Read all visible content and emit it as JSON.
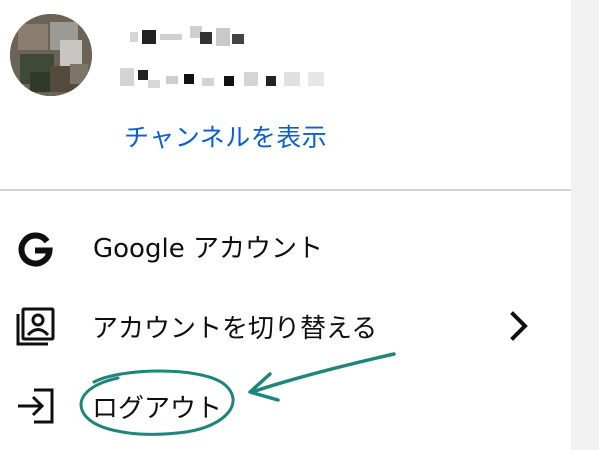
{
  "account": {
    "channel_link": "チャンネルを表示"
  },
  "menu": {
    "items": [
      {
        "label": "Google アカウント",
        "icon": "google-g-icon"
      },
      {
        "label": "アカウントを切り替える",
        "icon": "switch-account-icon",
        "trailing_icon": "chevron-right-icon"
      },
      {
        "label": "ログアウト",
        "icon": "sign-out-icon"
      }
    ]
  },
  "colors": {
    "link": "#065fd4",
    "text": "#0f0f0f",
    "divider": "#d3d3d3",
    "annotation": "#1e857a"
  }
}
